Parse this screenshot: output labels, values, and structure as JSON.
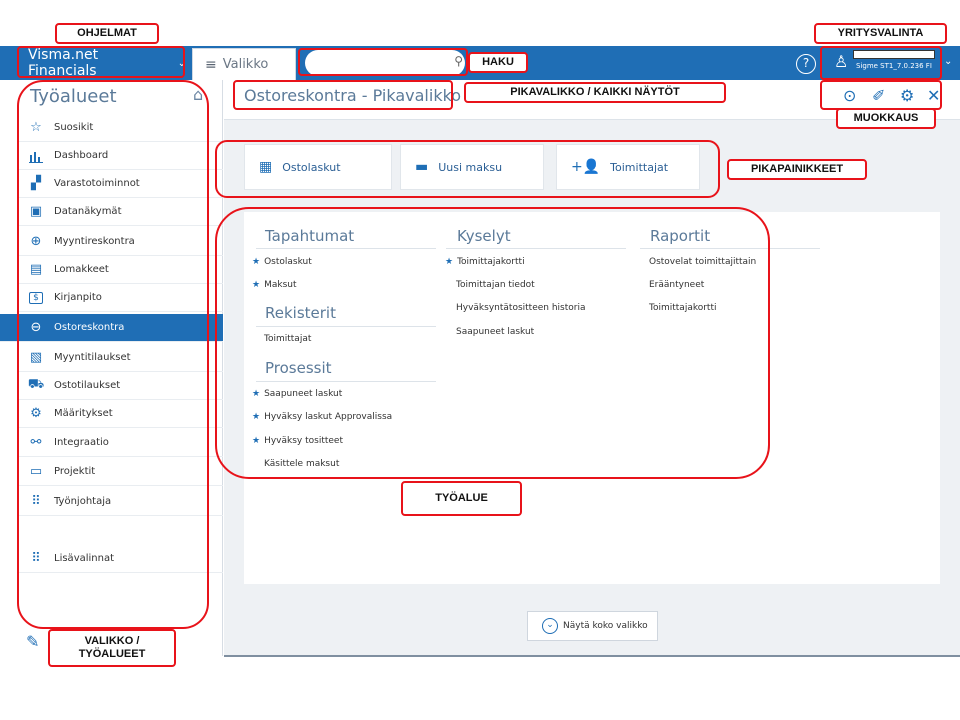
{
  "topbar": {
    "app_name": "Visma.net Financials",
    "menu_tab": "Valikko",
    "company_text": "Sigme ST1_7.0.236 FI"
  },
  "sidebar": {
    "title": "Työalueet",
    "items": [
      {
        "label": "Suosikit",
        "icon": "star-icon",
        "glyph": "☆"
      },
      {
        "label": "Dashboard",
        "icon": "bar-chart-icon",
        "glyph": "📊"
      },
      {
        "label": "Varastotoiminnot",
        "icon": "hand-truck-icon",
        "glyph": "▞"
      },
      {
        "label": "Datanäkymät",
        "icon": "data-view-icon",
        "glyph": "▣"
      },
      {
        "label": "Myyntireskontra",
        "icon": "plus-circle-icon",
        "glyph": "⊕"
      },
      {
        "label": "Lomakkeet",
        "icon": "forms-icon",
        "glyph": "▤"
      },
      {
        "label": "Kirjanpito",
        "icon": "ledger-icon",
        "glyph": "$"
      },
      {
        "label": "Ostoreskontra",
        "icon": "minus-circle-icon",
        "glyph": "⊖"
      },
      {
        "label": "Myyntitilaukset",
        "icon": "sales-order-icon",
        "glyph": "▧"
      },
      {
        "label": "Ostotilaukset",
        "icon": "truck-icon",
        "glyph": "⛟"
      },
      {
        "label": "Määritykset",
        "icon": "gear-icon",
        "glyph": "⚙"
      },
      {
        "label": "Integraatio",
        "icon": "integration-icon",
        "glyph": "⚯"
      },
      {
        "label": "Projektit",
        "icon": "project-icon",
        "glyph": "▭"
      },
      {
        "label": "Työnjohtaja",
        "icon": "grid-icon",
        "glyph": "⠿"
      },
      {
        "label": "Lisävalinnat",
        "icon": "grid-icon",
        "glyph": "⠿"
      }
    ]
  },
  "page": {
    "title": "Ostoreskontra - Pikavalikko"
  },
  "quick_buttons": [
    {
      "label": "Ostolaskut",
      "icon": "invoice-icon",
      "glyph": "▦"
    },
    {
      "label": "Uusi maksu",
      "icon": "card-icon",
      "glyph": "▬"
    },
    {
      "label": "Toimittajat",
      "icon": "add-user-icon",
      "glyph": "+👤"
    }
  ],
  "workspace": {
    "tapahtumat": {
      "heading": "Tapahtumat",
      "items": [
        {
          "label": "Ostolaskut",
          "star": "★"
        },
        {
          "label": "Maksut",
          "star": "★"
        }
      ]
    },
    "rekisterit": {
      "heading": "Rekisterit",
      "items": [
        {
          "label": "Toimittajat",
          "star": ""
        }
      ]
    },
    "prosessit": {
      "heading": "Prosessit",
      "items": [
        {
          "label": "Saapuneet laskut",
          "star": "★"
        },
        {
          "label": "Hyväksy laskut Approvalissa",
          "star": "★"
        },
        {
          "label": "Hyväksy tositteet",
          "star": "★"
        },
        {
          "label": "Käsittele maksut",
          "star": ""
        }
      ]
    },
    "kyselyt": {
      "heading": "Kyselyt",
      "items": [
        {
          "label": "Toimittajakortti",
          "star": "★"
        },
        {
          "label": "Toimittajan tiedot",
          "star": ""
        },
        {
          "label": "Hyväksyntätositteen historia",
          "star": ""
        },
        {
          "label": "Saapuneet laskut",
          "star": ""
        }
      ]
    },
    "raportit": {
      "heading": "Raportit",
      "items": [
        {
          "label": "Ostovelat toimittajittain",
          "star": ""
        },
        {
          "label": "Erääntyneet",
          "star": ""
        },
        {
          "label": "Toimittajakortti",
          "star": ""
        }
      ]
    }
  },
  "footer": {
    "full_menu_label": "Näytä koko valikko"
  },
  "annotations": {
    "ohjelmat": "OHJELMAT",
    "yritysvalinta": "YRITYSVALINTA",
    "haku": "HAKU",
    "pikavalikko": "PIKAVALIKKO / KAIKKI NÄYTÖT",
    "muokkaus": "MUOKKAUS",
    "pikapainikkeet": "PIKAPAINIKKEET",
    "tyoalue": "TYÖALUE",
    "valikko_line1": "VALIKKO /",
    "valikko_line2": "TYÖALUEET"
  },
  "colors": {
    "brand_blue": "#1f6eb5",
    "annotation_red": "#e8131a"
  }
}
